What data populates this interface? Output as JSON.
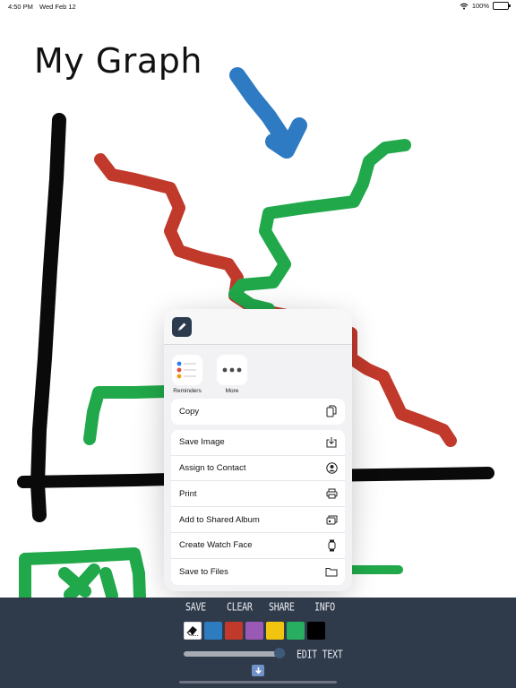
{
  "status_bar": {
    "time": "4:50 PM",
    "date": "Wed Feb 12",
    "battery": "100%",
    "wifi_icon": "wifi-icon",
    "battery_icon": "battery-icon"
  },
  "canvas": {
    "title": "My Graph",
    "stroke_colors": {
      "black": "#0a0a0a",
      "red": "#c0392b",
      "green": "#20a84a",
      "blue": "#2e7bc4"
    }
  },
  "share_sheet": {
    "app_icon": "pencil-icon",
    "apps": [
      {
        "label": "Reminders",
        "icon": "reminders-icon"
      },
      {
        "label": "More",
        "icon": "more-icon"
      }
    ],
    "copy": {
      "label": "Copy",
      "icon": "copy-icon"
    },
    "actions": [
      {
        "label": "Save Image",
        "icon": "save-image-icon"
      },
      {
        "label": "Assign to Contact",
        "icon": "contact-icon"
      },
      {
        "label": "Print",
        "icon": "printer-icon"
      },
      {
        "label": "Add to Shared Album",
        "icon": "shared-album-icon"
      },
      {
        "label": "Create Watch Face",
        "icon": "watch-icon"
      },
      {
        "label": "Save to Files",
        "icon": "folder-icon"
      }
    ]
  },
  "toolbar": {
    "tabs": [
      "SAVE",
      "CLEAR",
      "SHARE",
      "INFO"
    ],
    "palette": [
      {
        "name": "eraser",
        "color": "#ffffff",
        "icon": "eraser-icon"
      },
      {
        "name": "blue",
        "color": "#2d7cc0"
      },
      {
        "name": "red",
        "color": "#c0392b"
      },
      {
        "name": "purple",
        "color": "#9b59b6"
      },
      {
        "name": "yellow",
        "color": "#f1c40f"
      },
      {
        "name": "green",
        "color": "#27ae60"
      },
      {
        "name": "black",
        "color": "#000000"
      }
    ],
    "brush_size": 0.95,
    "edit_text_label": "EDIT TEXT",
    "download_icon": "arrow-down-icon",
    "background": "#2f3a4a"
  }
}
